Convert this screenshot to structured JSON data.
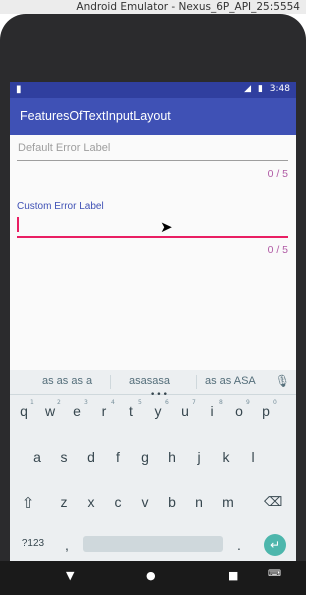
{
  "window": {
    "title": "Android Emulator - Nexus_6P_API_25:5554"
  },
  "status_bar": {
    "time": "3:48"
  },
  "app_bar": {
    "title": "FeaturesOfTextInputLayout"
  },
  "fields": {
    "default": {
      "hint": "Default Error Label",
      "counter": "0 / 5"
    },
    "custom": {
      "label": "Custom Error Label",
      "counter": "0 / 5"
    }
  },
  "keyboard": {
    "suggestions": [
      "as as as a",
      "asasasa",
      "as as ASA"
    ],
    "row1": [
      "q",
      "w",
      "e",
      "r",
      "t",
      "y",
      "u",
      "i",
      "o",
      "p"
    ],
    "row1_hints": [
      "1",
      "2",
      "3",
      "4",
      "5",
      "6",
      "7",
      "8",
      "9",
      "0"
    ],
    "row2": [
      "a",
      "s",
      "d",
      "f",
      "g",
      "h",
      "j",
      "k",
      "l"
    ],
    "row3": [
      "z",
      "x",
      "c",
      "v",
      "b",
      "n",
      "m"
    ],
    "symbols_label": "?123",
    "comma": ",",
    "period": "."
  },
  "icons": [
    "shift-icon",
    "backspace-icon",
    "enter-icon",
    "mic-icon",
    "back-icon",
    "home-icon",
    "recents-icon",
    "keyboard-icon"
  ]
}
